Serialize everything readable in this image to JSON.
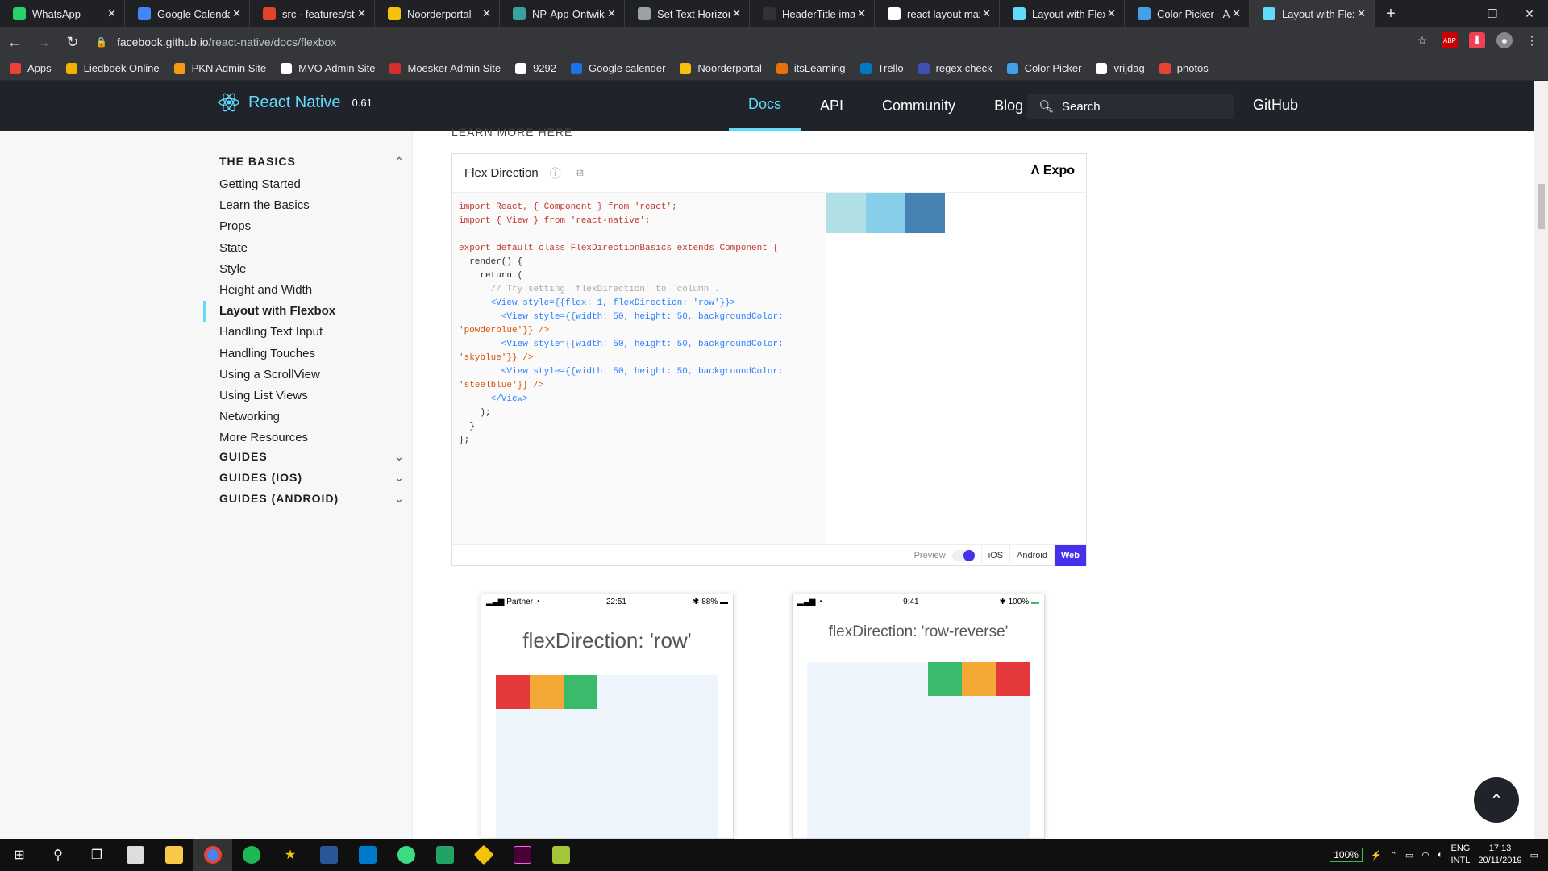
{
  "browser": {
    "tabs": [
      {
        "label": "WhatsApp",
        "color": "#25d366"
      },
      {
        "label": "Google Calendar",
        "color": "#4285f4"
      },
      {
        "label": "src · features/sty",
        "color": "#e24329"
      },
      {
        "label": "Noorderportal",
        "color": "#f4c20d"
      },
      {
        "label": "NP-App-Ontwikk",
        "color": "#3aa1a1"
      },
      {
        "label": "Set Text Horizon",
        "color": "#9aa0a6"
      },
      {
        "label": "HeaderTitle imag",
        "color": "#333333"
      },
      {
        "label": "react layout max",
        "color": "#ffffff"
      },
      {
        "label": "Layout with Flex",
        "color": "#61dafb"
      },
      {
        "label": "Color Picker - Al",
        "color": "#41a0e8"
      },
      {
        "label": "Layout with Flex",
        "color": "#61dafb"
      }
    ],
    "active_tab": 10,
    "new_tab": "+",
    "url_host": "facebook.github.io",
    "url_path": "/react-native/docs/flexbox",
    "bookmarks": [
      "Apps",
      "Liedboek Online",
      "PKN Admin Site",
      "MVO Admin Site",
      "Moesker Admin Site",
      "9292",
      "Google calender",
      "Noorderportal",
      "itsLearning",
      "Trello",
      "regex check",
      "Color Picker",
      "vrijdag",
      "photos"
    ],
    "bookmark_colors": [
      "#ea4335",
      "#f0b400",
      "#f39c12",
      "#ffffff",
      "#d32f2f",
      "#ffffff",
      "#1a73e8",
      "#f4c20d",
      "#e8710a",
      "#0079bf",
      "#3f51b5",
      "#41a0e8",
      "#ffffff",
      "#ea4335"
    ]
  },
  "site": {
    "brand": "React Native",
    "version": "0.61",
    "nav": [
      "Docs",
      "API",
      "Community",
      "Blog"
    ],
    "nav_active": "Docs",
    "search_placeholder": "Search",
    "github": "GitHub",
    "accent": "#61dafb",
    "header_bg": "#20232a"
  },
  "sidebar": {
    "basics_title": "THE BASICS",
    "items": [
      "Getting Started",
      "Learn the Basics",
      "Props",
      "State",
      "Style",
      "Height and Width",
      "Layout with Flexbox",
      "Handling Text Input",
      "Handling Touches",
      "Using a ScrollView",
      "Using List Views",
      "Networking",
      "More Resources"
    ],
    "active_item": "Layout with Flexbox",
    "sections": [
      "GUIDES",
      "GUIDES (IOS)",
      "GUIDES (ANDROID)"
    ]
  },
  "content": {
    "learn_more_cut": "LEARN MORE HERE",
    "snack_title": "Flex Direction",
    "expo_label": "Expo",
    "code_lines": [
      "import React, { Component } from 'react';",
      "import { View } from 'react-native';",
      "",
      "export default class FlexDirectionBasics extends Component {",
      "  render() {",
      "    return (",
      "      // Try setting `flexDirection` to `column`.",
      "      <View style={{flex: 1, flexDirection: 'row'}}>",
      "        <View style={{width: 50, height: 50, backgroundColor:",
      "'powderblue'}} />",
      "        <View style={{width: 50, height: 50, backgroundColor:",
      "'skyblue'}} />",
      "        <View style={{width: 50, height: 50, backgroundColor:",
      "'steelblue'}} />",
      "      </View>",
      "    );",
      "  }",
      "};"
    ],
    "preview_colors": [
      "#b0e0e6",
      "#87ceeb",
      "#4682b4"
    ],
    "footer": {
      "preview": "Preview",
      "platforms": [
        "iOS",
        "Android",
        "Web"
      ],
      "selected": "Web"
    },
    "phone1": {
      "carrier": "Partner",
      "time": "22:51",
      "battery": "88%",
      "title": "flexDirection: 'row'",
      "colors": [
        "#e5383b",
        "#f4a836",
        "#3cba6b"
      ]
    },
    "phone2": {
      "carrier": "",
      "time": "9:41",
      "battery": "100%",
      "title": "flexDirection: 'row-reverse'",
      "colors": [
        "#3cba6b",
        "#f4a836",
        "#e5383b"
      ]
    }
  },
  "taskbar": {
    "battery": "100%",
    "lang": "ENG",
    "layout": "INTL",
    "time": "17:13",
    "date": "20/11/2019"
  }
}
